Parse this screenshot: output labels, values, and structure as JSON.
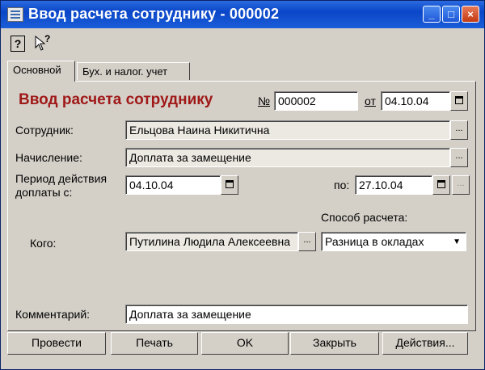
{
  "window": {
    "title": "Ввод расчета сотруднику - 000002",
    "controls": [
      "_",
      "□",
      "×"
    ]
  },
  "toolbar": {
    "help_icon": "?",
    "whats_this_icon": "?"
  },
  "tabs": [
    {
      "label": "Основной",
      "active": true
    },
    {
      "label": "Бух. и налог. учет",
      "active": false
    }
  ],
  "form": {
    "heading": "Ввод расчета сотруднику",
    "number_label": "№",
    "number_value": "000002",
    "date_label": "от",
    "date_value": "04.10.04",
    "employee_label": "Сотрудник:",
    "employee_value": "Ельцова Наина Никитична",
    "accrual_label": "Начисление:",
    "accrual_value": "Доплата за замещение",
    "period_label_line1": "Период действия",
    "period_label_line2": "доплаты с:",
    "period_from": "04.10.04",
    "period_to_label": "по:",
    "period_to": "27.10.04",
    "calc_method_label": "Способ расчета:",
    "whom_label": "Кого:",
    "whom_value": "Путилина Людила Алексеевна",
    "calc_method_value": "Разница в окладах",
    "comment_label": "Комментарий:",
    "comment_value": "Доплата за замещение",
    "ellipsis": "...",
    "dropdown_arrow": "▼"
  },
  "buttons": {
    "post": "Провести",
    "print": "Печать",
    "ok": "OK",
    "close": "Закрыть",
    "actions": "Действия..."
  }
}
